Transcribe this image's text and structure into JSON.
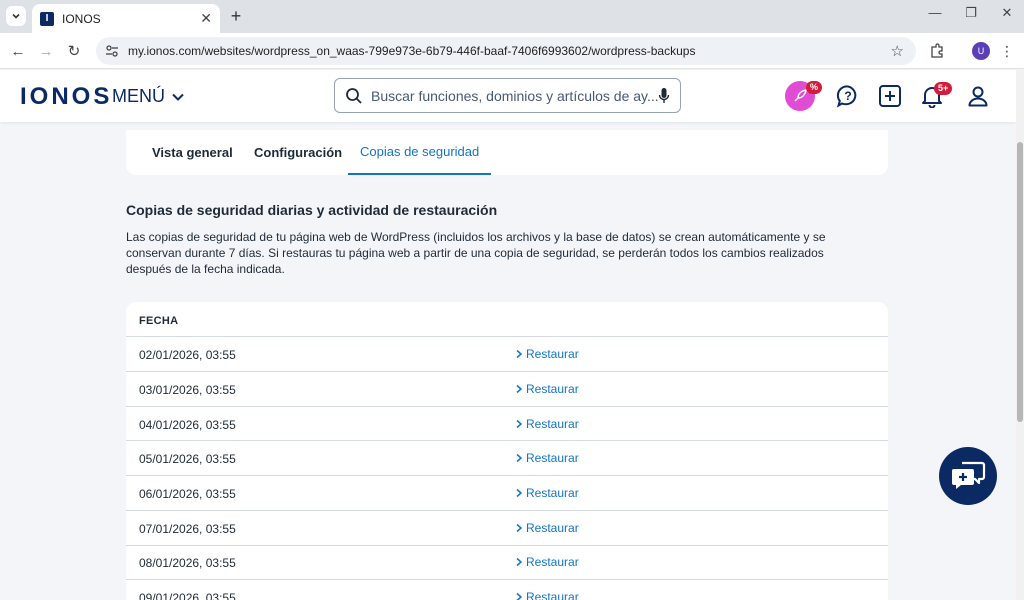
{
  "browser": {
    "tab_title": "IONOS",
    "favicon_letter": "I",
    "url": "my.ionos.com/websites/wordpress_on_waas-799e973e-6b79-446f-baaf-7406f6993602/wordpress-backups",
    "profile_initial": "U"
  },
  "header": {
    "logo": "IONOS",
    "menu_label": "MENÚ",
    "search_placeholder": "Buscar funciones, dominios y artículos de ay...",
    "promo_badge": "%",
    "notification_badge": "5+"
  },
  "tabs": [
    {
      "label": "Vista general",
      "active": false
    },
    {
      "label": "Configuración",
      "active": false
    },
    {
      "label": "Copias de seguridad",
      "active": true
    }
  ],
  "section": {
    "title": "Copias de seguridad diarias y actividad de restauración",
    "description": "Las copias de seguridad de tu página web de WordPress (incluidos los archivos y la base de datos) se crean automáticamente y se conservan durante 7 días. Si restauras tu página web a partir de una copia de seguridad, se perderán todos los cambios realizados después de la fecha indicada."
  },
  "table": {
    "header": "FECHA",
    "action_label": "Restaurar",
    "rows": [
      "02/01/2026, 03:55",
      "03/01/2026, 03:55",
      "04/01/2026, 03:55",
      "05/01/2026, 03:55",
      "06/01/2026, 03:55",
      "07/01/2026, 03:55",
      "08/01/2026, 03:55",
      "09/01/2026, 03:55"
    ]
  },
  "colors": {
    "brand_navy": "#0b2a63",
    "link_blue": "#1474c4",
    "promo_pink": "#e04cd3",
    "badge_red": "#d41b3c"
  }
}
